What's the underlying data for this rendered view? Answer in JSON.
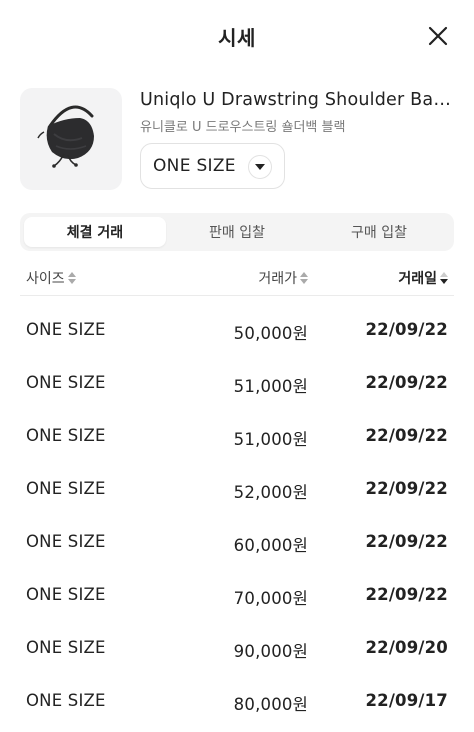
{
  "header": {
    "title": "시세"
  },
  "product": {
    "title": "Uniqlo U Drawstring Shoulder Bag Bl...",
    "subtitle": "유니클로 U 드로우스트링 숄더백 블랙",
    "size_selected": "ONE SIZE"
  },
  "tabs": [
    {
      "label": "체결 거래",
      "active": true
    },
    {
      "label": "판매 입찰",
      "active": false
    },
    {
      "label": "구매 입찰",
      "active": false
    }
  ],
  "table": {
    "headers": {
      "size": "사이즈",
      "price": "거래가",
      "date": "거래일"
    },
    "rows": [
      {
        "size": "ONE SIZE",
        "price": "50,000원",
        "date": "22/09/22"
      },
      {
        "size": "ONE SIZE",
        "price": "51,000원",
        "date": "22/09/22"
      },
      {
        "size": "ONE SIZE",
        "price": "51,000원",
        "date": "22/09/22"
      },
      {
        "size": "ONE SIZE",
        "price": "52,000원",
        "date": "22/09/22"
      },
      {
        "size": "ONE SIZE",
        "price": "60,000원",
        "date": "22/09/22"
      },
      {
        "size": "ONE SIZE",
        "price": "70,000원",
        "date": "22/09/22"
      },
      {
        "size": "ONE SIZE",
        "price": "90,000원",
        "date": "22/09/20"
      },
      {
        "size": "ONE SIZE",
        "price": "80,000원",
        "date": "22/09/17"
      }
    ]
  },
  "icons": {
    "close": "close-icon",
    "caret": "caret-down-icon",
    "sort": "sort-icon"
  }
}
